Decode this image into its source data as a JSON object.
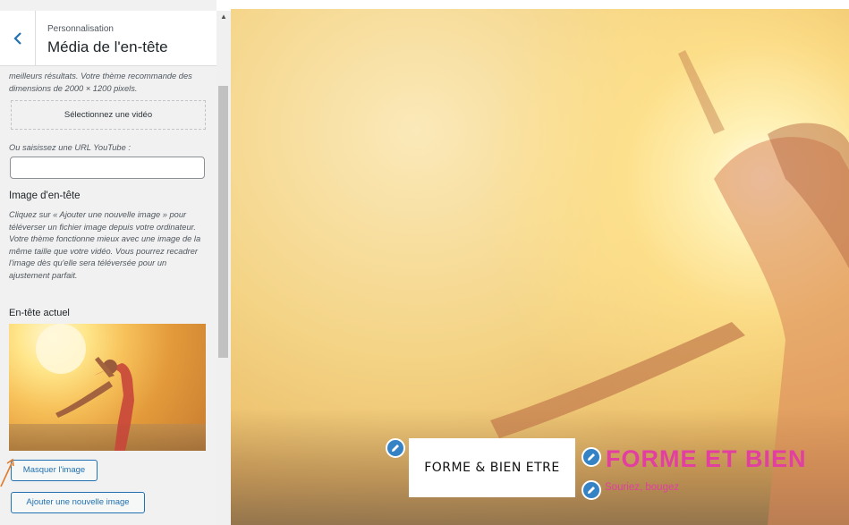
{
  "sidebar": {
    "breadcrumb": "Personnalisation",
    "panel_title": "Média de l'en-tête",
    "video_desc": "meilleurs résultats. Votre thème recommande des dimensions de 2000 × 1200 pixels.",
    "select_video_label": "Sélectionnez une vidéo",
    "youtube_label": "Ou saisissez une URL YouTube :",
    "youtube_value": "",
    "image_heading": "Image d'en-tête",
    "image_desc": "Cliquez sur « Ajouter une nouvelle image » pour téléverser un fichier image depuis votre ordinateur. Votre thème fonctionne mieux avec une image de la même taille que votre vidéo. Vous pourrez recadrer l'image dès qu'elle sera téléversée pour un ajustement parfait.",
    "current_heading": "En-tête actuel",
    "hide_image_label": "Masquer l'image",
    "add_image_label": "Ajouter une nouvelle image"
  },
  "preview": {
    "logo_text": "FORME & BIEN ETRE",
    "site_title": "FORME ET BIEN",
    "tagline": "Souriez, bougez"
  },
  "icons": {
    "back": "chevron-left-icon",
    "edit": "pencil-icon",
    "scroll_up": "triangle-up-icon"
  },
  "colors": {
    "accent": "#2271b1",
    "edit_badge": "#3582c4",
    "title_pink": "#e23fa0",
    "arrow": "#e07b2c"
  }
}
